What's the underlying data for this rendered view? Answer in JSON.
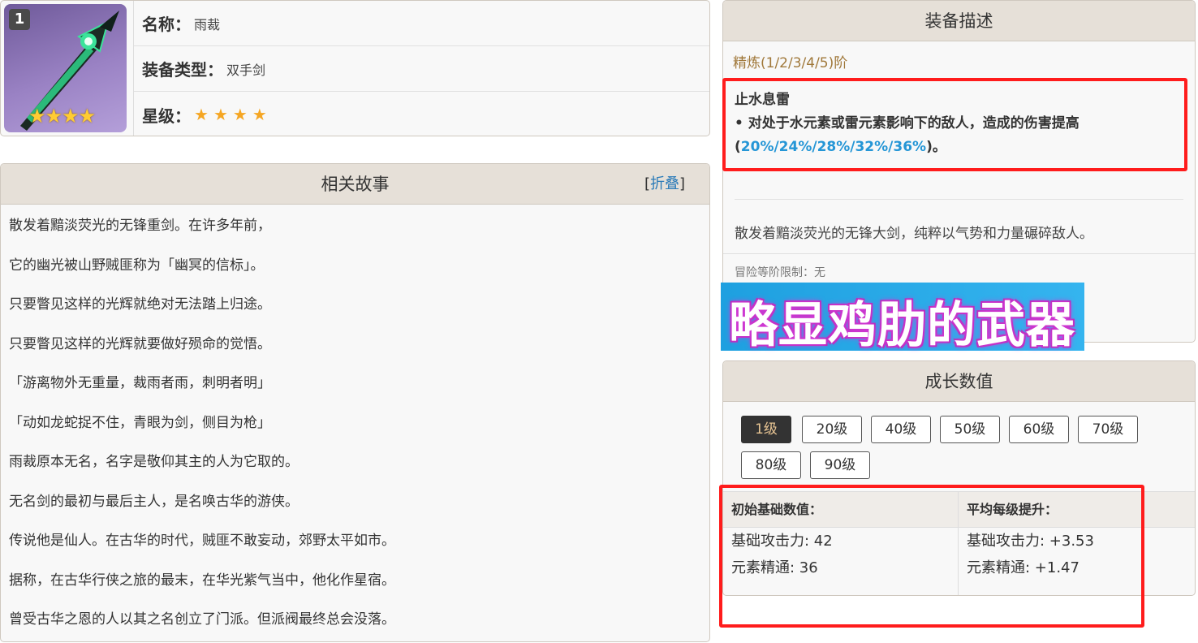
{
  "info": {
    "rank": "1",
    "name_key": "名称：",
    "name_value": "雨裁",
    "type_key": "装备类型：",
    "type_value": "双手剑",
    "rarity_key": "星级：",
    "rarity_stars": 4,
    "star_glyph": "★",
    "thumb_stars": "★★★★"
  },
  "story": {
    "title": "相关故事",
    "fold_open": "[",
    "fold_label": "折叠",
    "fold_close": "]",
    "lines": [
      "散发着黯淡荧光的无锋重剑。在许多年前，",
      "它的幽光被山野贼匪称为「幽冥的信标」。",
      "只要瞥见这样的光辉就绝对无法踏上归途。",
      "只要瞥见这样的光辉就要做好殒命的觉悟。",
      "「游离物外无重量，裁雨者雨，刺明者明」",
      "「动如龙蛇捉不住，青眼为剑，侧目为枪」",
      "雨裁原本无名，名字是敬仰其主的人为它取的。",
      "无名剑的最初与最后主人，是名唤古华的游侠。",
      "传说他是仙人。在古华的时代，贼匪不敢妄动，郊野太平如市。",
      "据称，在古华行侠之旅的最末，在华光紫气当中，他化作星宿。",
      "曾受古华之恩的人以其之名创立了门派。但派阀最终总会没落。"
    ]
  },
  "description": {
    "title": "装备描述",
    "refinement": "精炼(1/2/3/4/5)阶",
    "passive_name": "止水息雷",
    "passive_prefix": "• 对处于水元素或雷元素影响下的敌人，造成的伤害提高(",
    "passive_values": "20%/24%/28%/32%/36%",
    "passive_suffix": ")。",
    "flavor": "散发着黯淡荧光的无锋大剑，纯粹以气势和力量碾碎敌人。",
    "ar_limit": "冒险等阶限制：无"
  },
  "overlay": {
    "text": "略显鸡肋的武器"
  },
  "growth": {
    "title": "成长数值",
    "levels": [
      "1级",
      "20级",
      "40级",
      "50级",
      "60级",
      "70级",
      "80级",
      "90级"
    ],
    "active_level": "1级",
    "base_header": "初始基础数值：",
    "avg_header": "平均每级提升：",
    "base_atk": "基础攻击力: 42",
    "base_em": "元素精通: 36",
    "avg_atk": "基础攻击力: +3.53",
    "avg_em": "元素精通: +1.47"
  },
  "colors": {
    "highlight_blue": "#2596d6",
    "annotation_red": "#ff1c1c",
    "refine_gold": "#a0783a",
    "star_gold": "#f5a623"
  }
}
